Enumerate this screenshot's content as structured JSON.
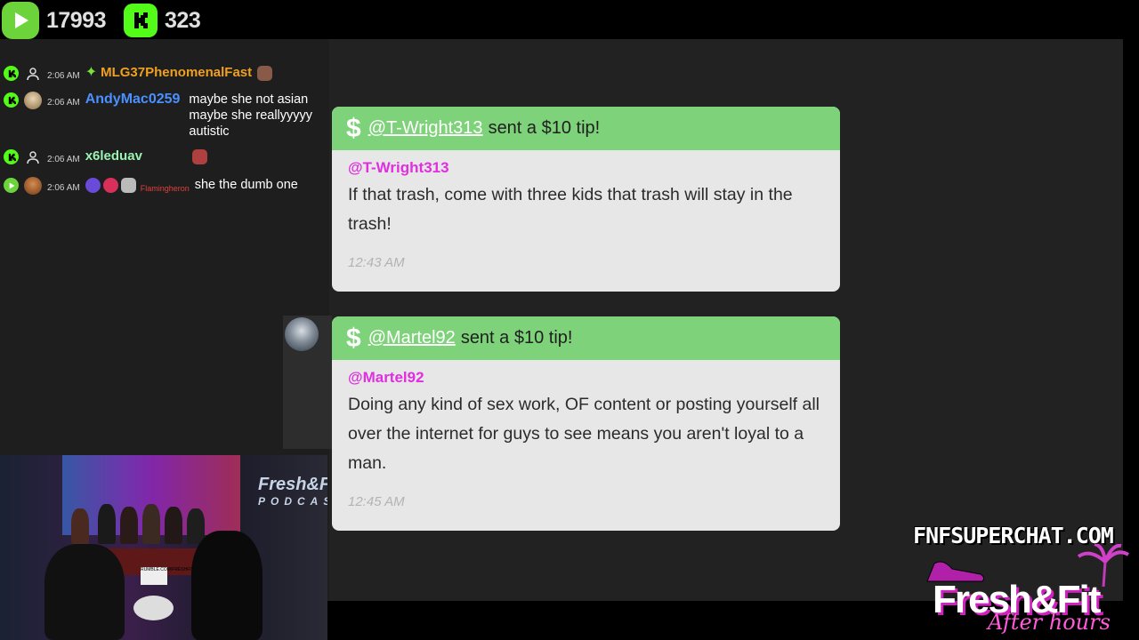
{
  "stats": {
    "rumble_viewers": "17993",
    "kick_viewers": "323"
  },
  "chat": [
    {
      "platform": "kick",
      "time": "2:06 AM",
      "username": "MLG37PhenomenalFast",
      "username_color": "#f0a021",
      "message": ""
    },
    {
      "platform": "kick",
      "time": "2:06 AM",
      "username": "AndyMac0259",
      "username_color": "#4a90ff",
      "message": "maybe she not asian maybe she reallyyyyy autistic"
    },
    {
      "platform": "kick",
      "time": "2:06 AM",
      "username": "x6leduav",
      "username_color": "#9af2b3",
      "message": ""
    },
    {
      "platform": "rumble",
      "time": "2:06 AM",
      "username": "Flamingheron",
      "username_color": "#e0413a",
      "message": "she the dumb one"
    }
  ],
  "tips": [
    {
      "handle": "@T-Wright313",
      "action": "sent a $10 tip!",
      "user": "@T-Wright313",
      "text": "If that trash, come with three kids that trash will stay in the trash!",
      "time": "12:43 AM"
    },
    {
      "handle": "@Martel92",
      "action": "sent a $10 tip!",
      "user": "@Martel92",
      "text": "Doing any kind of sex work, OF content or posting yourself all over the internet for guys to see means you aren't loyal to a man.",
      "time": "12:45 AM"
    }
  ],
  "cam": {
    "sign": "Fresh&Fit",
    "sign_sub": "PODCAST",
    "table_sign": "RUMBLE.COM/FRESHFIT"
  },
  "branding": {
    "site": "FNFSUPERCHAT.COM",
    "brand": "Fresh&Fit",
    "brand_sub": "After hours"
  },
  "colors": {
    "kick_green": "#53fc18",
    "rumble_green": "#6cd43a",
    "tip_header": "#7ed37a",
    "tip_body": "#e7e7e7",
    "tip_user": "#e02ee0"
  }
}
